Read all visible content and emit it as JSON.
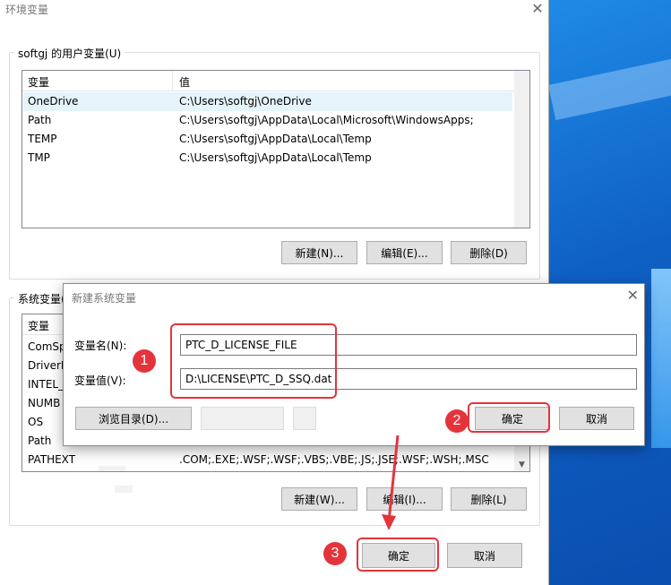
{
  "window": {
    "title": "环境变量",
    "close": "✕"
  },
  "user_vars": {
    "group_label": "softgj 的用户变量(U)",
    "columns": [
      "变量",
      "值"
    ],
    "rows": [
      {
        "name": "OneDrive",
        "value": "C:\\Users\\softgj\\OneDrive"
      },
      {
        "name": "Path",
        "value": "C:\\Users\\softgj\\AppData\\Local\\Microsoft\\WindowsApps;"
      },
      {
        "name": "TEMP",
        "value": "C:\\Users\\softgj\\AppData\\Local\\Temp"
      },
      {
        "name": "TMP",
        "value": "C:\\Users\\softgj\\AppData\\Local\\Temp"
      }
    ],
    "buttons": {
      "new": "新建(N)...",
      "edit": "编辑(E)...",
      "delete": "删除(D)"
    }
  },
  "sys_vars": {
    "group_label": "系统变量(",
    "columns": [
      "变量"
    ],
    "rows": [
      {
        "name": "ComSp",
        "value": ""
      },
      {
        "name": "DriverD",
        "value": ""
      },
      {
        "name": "INTEL_",
        "value": ""
      },
      {
        "name": "NUMB",
        "value": ""
      },
      {
        "name": "OS",
        "value": ""
      },
      {
        "name": "Path",
        "value": ""
      },
      {
        "name": "PATHEXT",
        "value": ".COM;.EXE;.WSF;.WSF;.VBS;.VBE;.JS;.JSE;.WSF;.WSH;.MSC"
      }
    ],
    "buttons": {
      "new": "新建(W)...",
      "edit": "编辑(I)...",
      "delete": "删除(L)"
    }
  },
  "footer": {
    "ok": "确定",
    "cancel": "取消"
  },
  "new_dialog": {
    "title": "新建系统变量",
    "close": "✕",
    "name_label": "变量名(N):",
    "name_value": "PTC_D_LICENSE_FILE",
    "value_label": "变量值(V):",
    "value_value": "D:\\LICENSE\\PTC_D_SSQ.dat",
    "browse_dir": "浏览目录(D)...",
    "ok": "确定",
    "cancel": "取消"
  },
  "annotations": {
    "step1": "1",
    "step2": "2",
    "step3": "3",
    "color": "#e3343c"
  }
}
